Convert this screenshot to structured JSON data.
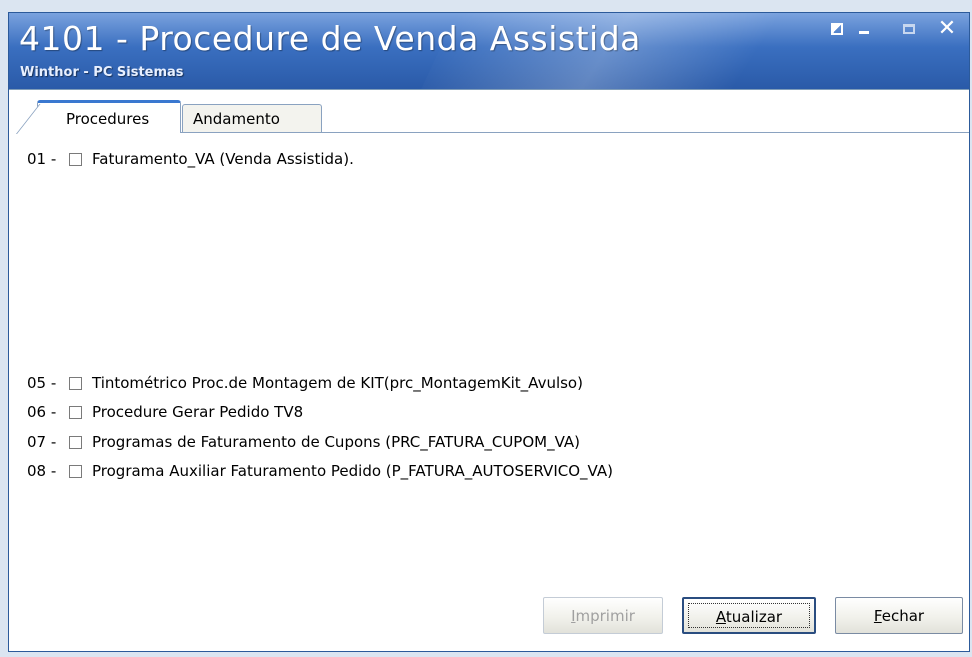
{
  "window": {
    "title": "4101 - Procedure de Venda Assistida",
    "subtitle": "Winthor - PC Sistemas",
    "accent": "#3a6fc0"
  },
  "tabs": [
    {
      "label": "Procedures",
      "active": true
    },
    {
      "label": "Andamento",
      "active": false
    }
  ],
  "procedures": [
    {
      "num": "01 -",
      "label": "Faturamento_VA (Venda Assistida).",
      "checked": false
    },
    {
      "num": "05 -",
      "label": "Tintométrico Proc.de Montagem de KIT(prc_MontagemKit_Avulso)",
      "checked": false
    },
    {
      "num": "06 -",
      "label": "Procedure Gerar Pedido TV8",
      "checked": false
    },
    {
      "num": "07 -",
      "label": "Programas de Faturamento de Cupons (PRC_FATURA_CUPOM_VA)",
      "checked": false
    },
    {
      "num": "08 -",
      "label": "Programa Auxiliar Faturamento Pedido  (P_FATURA_AUTOSERVICO_VA)",
      "checked": false
    }
  ],
  "buttons": {
    "print": {
      "first": "I",
      "rest": "mprimir",
      "enabled": false
    },
    "update": {
      "first": "A",
      "rest": "tualizar"
    },
    "close": {
      "first": "F",
      "rest": "echar"
    }
  }
}
